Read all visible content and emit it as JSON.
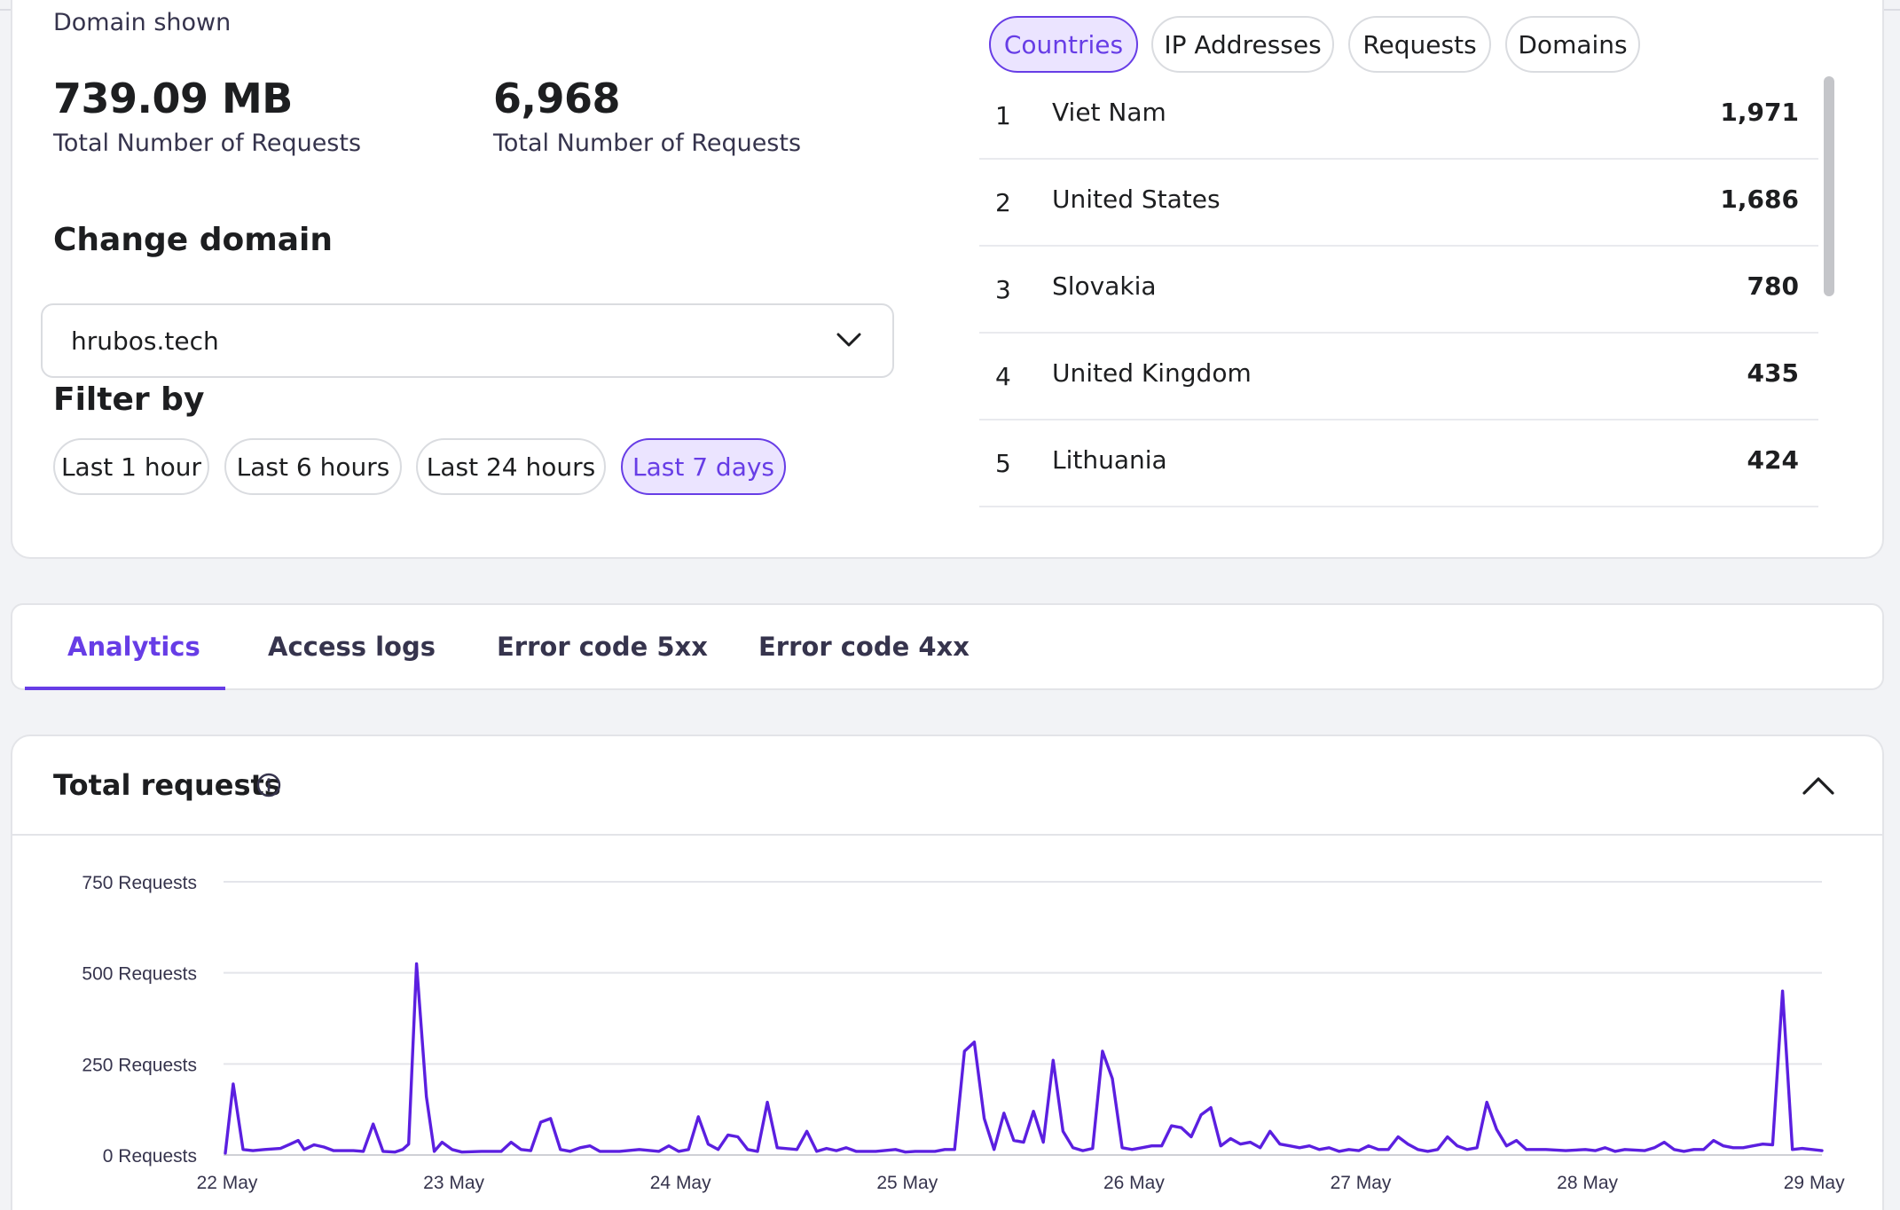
{
  "summary": {
    "domain_shown_label": "Domain shown",
    "stats": [
      {
        "value": "739.09 MB",
        "label": "Total Number of Requests"
      },
      {
        "value": "6,968",
        "label": "Total Number of Requests"
      }
    ]
  },
  "change_domain": {
    "title": "Change domain",
    "selected": "hrubos.tech"
  },
  "filter": {
    "title": "Filter by",
    "options": [
      "Last 1 hour",
      "Last 6 hours",
      "Last 24 hours",
      "Last 7 days"
    ],
    "active": "Last 7 days"
  },
  "top_list": {
    "tabs": [
      "Countries",
      "IP Addresses",
      "Requests",
      "Domains"
    ],
    "active_tab": "Countries",
    "rows": [
      {
        "rank": "1",
        "name": "Viet Nam",
        "count": "1,971"
      },
      {
        "rank": "2",
        "name": "United States",
        "count": "1,686"
      },
      {
        "rank": "3",
        "name": "Slovakia",
        "count": "780"
      },
      {
        "rank": "4",
        "name": "United Kingdom",
        "count": "435"
      },
      {
        "rank": "5",
        "name": "Lithuania",
        "count": "424"
      }
    ]
  },
  "page_tabs": {
    "items": [
      "Analytics",
      "Access logs",
      "Error code 5xx",
      "Error code 4xx"
    ],
    "active": "Analytics"
  },
  "chart_panel": {
    "title": "Total requests"
  },
  "colors": {
    "accent": "#673de6",
    "accent_bg": "#ebe4ff",
    "line": "#5b1fe0"
  },
  "chart_data": {
    "type": "line",
    "title": "Total requests",
    "y_ticks": [
      "0 Requests",
      "250 Requests",
      "500 Requests",
      "750 Requests"
    ],
    "y_tick_values": [
      0,
      250,
      500,
      750
    ],
    "ylim": [
      0,
      750
    ],
    "x_ticks": [
      "22 May",
      "23 May",
      "24 May",
      "25 May",
      "26 May",
      "27 May",
      "28 May",
      "29 May"
    ],
    "xlim": [
      0,
      7.07
    ],
    "grid": true,
    "series": [
      {
        "values": [
          [
            0.0,
            5
          ],
          [
            0.04,
            195
          ],
          [
            0.09,
            15
          ],
          [
            0.14,
            12
          ],
          [
            0.2,
            15
          ],
          [
            0.28,
            18
          ],
          [
            0.33,
            30
          ],
          [
            0.37,
            40
          ],
          [
            0.4,
            15
          ],
          [
            0.45,
            28
          ],
          [
            0.5,
            22
          ],
          [
            0.55,
            12
          ],
          [
            0.65,
            12
          ],
          [
            0.7,
            10
          ],
          [
            0.75,
            85
          ],
          [
            0.8,
            10
          ],
          [
            0.86,
            8
          ],
          [
            0.9,
            15
          ],
          [
            0.93,
            30
          ],
          [
            0.97,
            525
          ],
          [
            1.02,
            160
          ],
          [
            1.06,
            10
          ],
          [
            1.1,
            35
          ],
          [
            1.15,
            15
          ],
          [
            1.2,
            8
          ],
          [
            1.3,
            10
          ],
          [
            1.4,
            10
          ],
          [
            1.45,
            35
          ],
          [
            1.5,
            15
          ],
          [
            1.55,
            12
          ],
          [
            1.6,
            90
          ],
          [
            1.65,
            100
          ],
          [
            1.7,
            15
          ],
          [
            1.75,
            10
          ],
          [
            1.8,
            20
          ],
          [
            1.85,
            25
          ],
          [
            1.9,
            10
          ],
          [
            2.0,
            10
          ],
          [
            2.1,
            15
          ],
          [
            2.2,
            10
          ],
          [
            2.25,
            25
          ],
          [
            2.3,
            10
          ],
          [
            2.35,
            15
          ],
          [
            2.4,
            105
          ],
          [
            2.45,
            30
          ],
          [
            2.5,
            15
          ],
          [
            2.55,
            55
          ],
          [
            2.6,
            50
          ],
          [
            2.65,
            15
          ],
          [
            2.7,
            10
          ],
          [
            2.75,
            145
          ],
          [
            2.8,
            20
          ],
          [
            2.9,
            15
          ],
          [
            2.95,
            65
          ],
          [
            3.0,
            10
          ],
          [
            3.05,
            18
          ],
          [
            3.1,
            12
          ],
          [
            3.15,
            20
          ],
          [
            3.2,
            10
          ],
          [
            3.3,
            10
          ],
          [
            3.4,
            15
          ],
          [
            3.45,
            8
          ],
          [
            3.5,
            10
          ],
          [
            3.6,
            10
          ],
          [
            3.65,
            15
          ],
          [
            3.7,
            15
          ],
          [
            3.75,
            285
          ],
          [
            3.8,
            310
          ],
          [
            3.85,
            100
          ],
          [
            3.9,
            15
          ],
          [
            3.95,
            115
          ],
          [
            4.0,
            40
          ],
          [
            4.05,
            35
          ],
          [
            4.1,
            120
          ],
          [
            4.15,
            35
          ],
          [
            4.2,
            260
          ],
          [
            4.25,
            65
          ],
          [
            4.3,
            20
          ],
          [
            4.35,
            12
          ],
          [
            4.4,
            18
          ],
          [
            4.45,
            285
          ],
          [
            4.5,
            210
          ],
          [
            4.55,
            20
          ],
          [
            4.6,
            15
          ],
          [
            4.65,
            20
          ],
          [
            4.7,
            25
          ],
          [
            4.75,
            25
          ],
          [
            4.8,
            80
          ],
          [
            4.85,
            75
          ],
          [
            4.9,
            50
          ],
          [
            4.95,
            110
          ],
          [
            5.0,
            130
          ],
          [
            5.05,
            25
          ],
          [
            5.1,
            45
          ],
          [
            5.15,
            30
          ],
          [
            5.2,
            35
          ],
          [
            5.25,
            20
          ],
          [
            5.3,
            65
          ],
          [
            5.35,
            30
          ],
          [
            5.4,
            25
          ],
          [
            5.45,
            20
          ],
          [
            5.5,
            25
          ],
          [
            5.55,
            15
          ],
          [
            5.6,
            20
          ],
          [
            5.65,
            10
          ],
          [
            5.7,
            15
          ],
          [
            5.75,
            12
          ],
          [
            5.8,
            25
          ],
          [
            5.85,
            15
          ],
          [
            5.9,
            15
          ],
          [
            5.95,
            50
          ],
          [
            6.0,
            30
          ],
          [
            6.05,
            15
          ],
          [
            6.1,
            10
          ],
          [
            6.15,
            15
          ],
          [
            6.2,
            50
          ],
          [
            6.25,
            25
          ],
          [
            6.3,
            15
          ],
          [
            6.35,
            20
          ],
          [
            6.4,
            145
          ],
          [
            6.45,
            70
          ],
          [
            6.5,
            25
          ],
          [
            6.55,
            40
          ],
          [
            6.6,
            15
          ],
          [
            6.7,
            15
          ],
          [
            6.8,
            12
          ],
          [
            6.9,
            15
          ],
          [
            6.95,
            12
          ],
          [
            7.0,
            20
          ],
          [
            7.05,
            10
          ],
          [
            7.1,
            15
          ],
          [
            7.2,
            12
          ],
          [
            7.25,
            20
          ],
          [
            7.3,
            35
          ],
          [
            7.35,
            15
          ],
          [
            7.4,
            10
          ],
          [
            7.45,
            15
          ],
          [
            7.5,
            15
          ],
          [
            7.55,
            40
          ],
          [
            7.6,
            25
          ],
          [
            7.65,
            20
          ],
          [
            7.7,
            20
          ],
          [
            7.75,
            25
          ],
          [
            7.8,
            30
          ],
          [
            7.85,
            28
          ],
          [
            7.9,
            450
          ],
          [
            7.95,
            15
          ],
          [
            8.0,
            18
          ],
          [
            8.05,
            15
          ],
          [
            8.1,
            12
          ]
        ]
      }
    ]
  }
}
